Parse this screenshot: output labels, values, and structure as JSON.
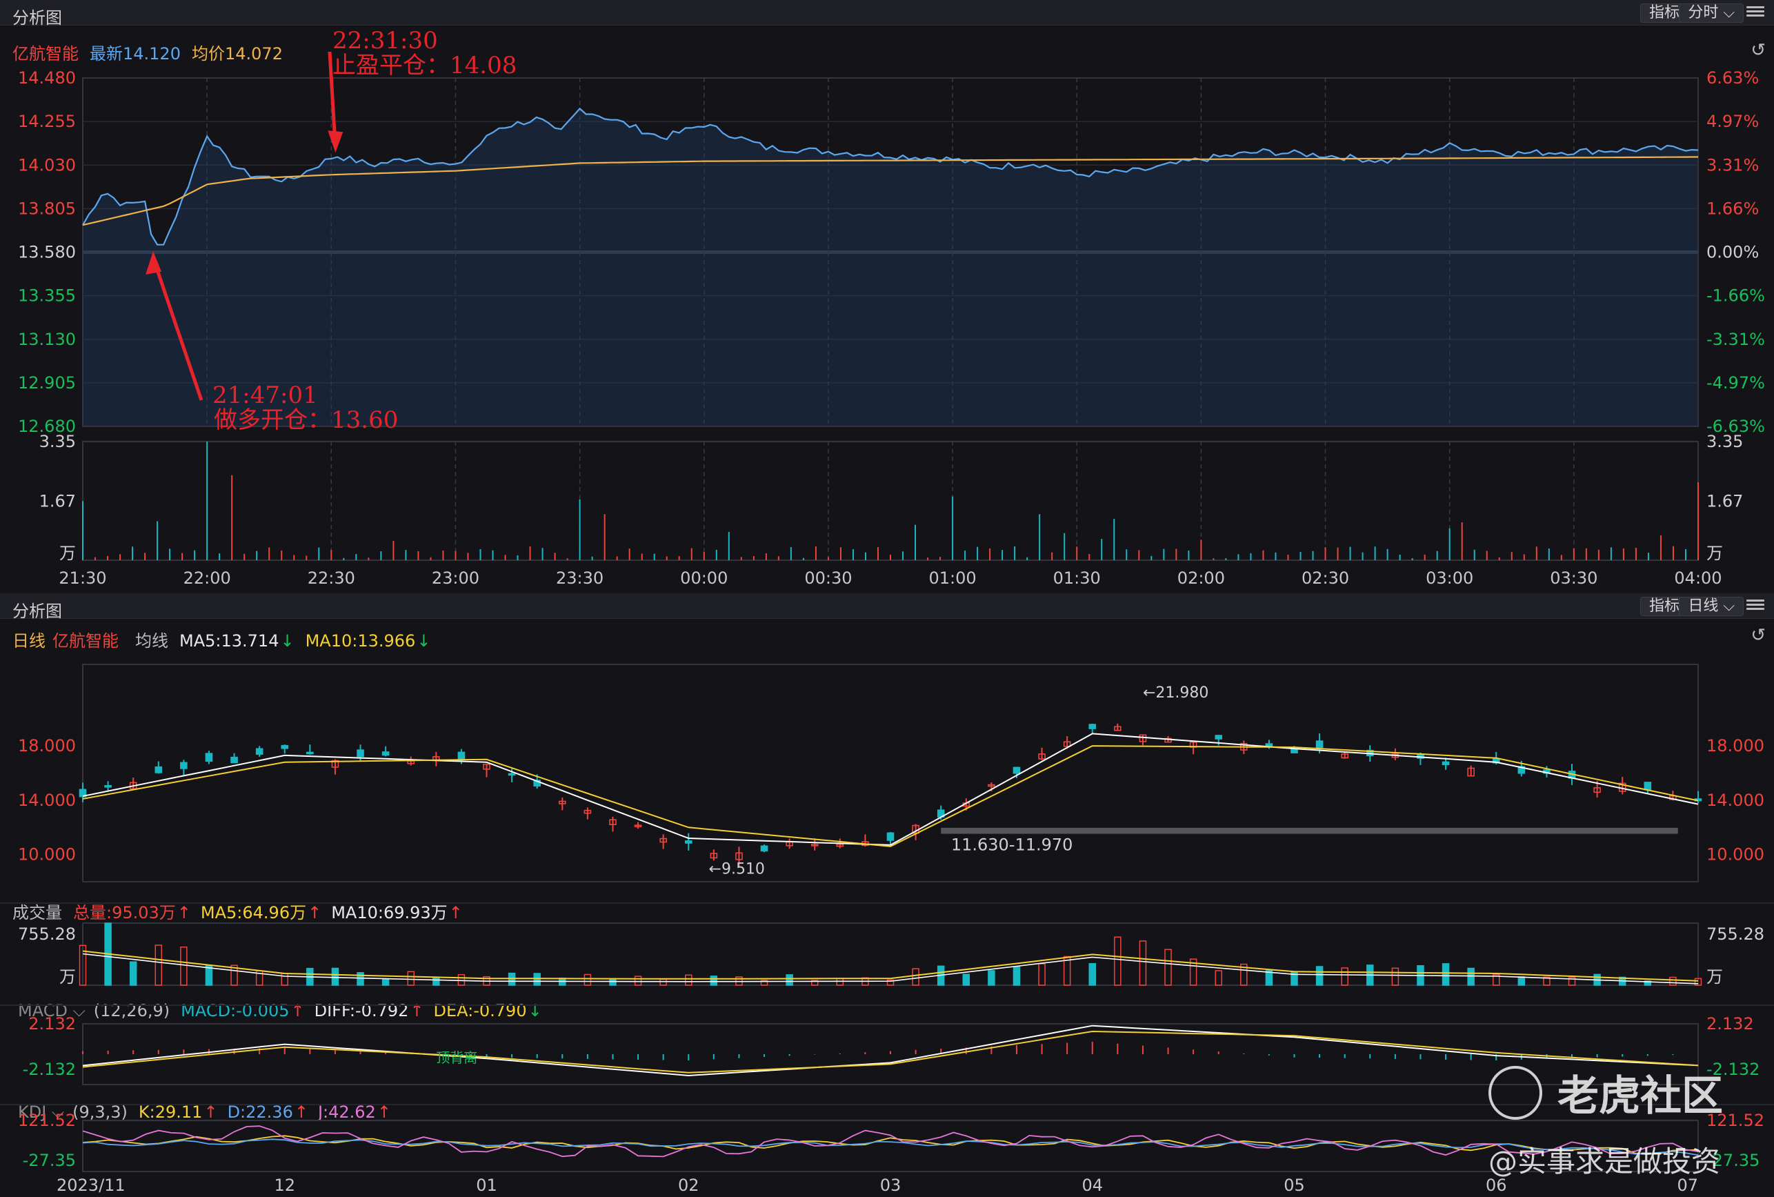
{
  "top": {
    "panel_title": "分析图",
    "indicator_btn": "指标",
    "period_btn": "分时 ⌵",
    "stock": "亿航智能",
    "latest_label": "最新14.120",
    "avg_label": "均价14.072",
    "price_ticks": [
      "14.480",
      "14.255",
      "14.030",
      "13.805",
      "13.580",
      "13.355",
      "13.130",
      "12.905",
      "12.680"
    ],
    "pct_ticks": [
      "6.63%",
      "4.97%",
      "3.31%",
      "1.66%",
      "0.00%",
      "-1.66%",
      "-3.31%",
      "-4.97%",
      "-6.63%"
    ],
    "vol_ticks": [
      "3.35",
      "1.67",
      "万"
    ],
    "time_ticks": [
      "21:30",
      "22:00",
      "22:30",
      "23:00",
      "23:30",
      "00:00",
      "00:30",
      "01:00",
      "01:30",
      "02:00",
      "02:30",
      "03:00",
      "03:30",
      "04:00"
    ],
    "ann_close_time": "22:31:30",
    "ann_close_text": "止盈平仓：14.08",
    "ann_open_time": "21:47:01",
    "ann_open_text": "做多开仓：13.60"
  },
  "bottom": {
    "panel_title": "分析图",
    "indicator_btn": "指标",
    "period_btn": "日线 ⌵",
    "kline_label": "日线",
    "stock": "亿航智能",
    "ma_label": "均线",
    "ma5": "MA5:13.714",
    "ma10": "MA10:13.966",
    "price_ticks": [
      "18.000",
      "14.000",
      "10.000"
    ],
    "high_label": "←21.980",
    "low_label": "←9.510",
    "range_label": "11.630-11.970",
    "vol_title": "成交量",
    "vol_total": "总量:95.03万",
    "vol_ma5": "MA5:64.96万",
    "vol_ma10": "MA10:69.93万",
    "vol_ticks": [
      "755.28",
      "万"
    ],
    "macd_name": "MACD ⌵",
    "macd_params": "(12,26,9)",
    "macd_val": "MACD:-0.005",
    "diff_val": "DIFF:-0.792",
    "dea_val": "DEA:-0.790",
    "macd_ticks": [
      "2.132",
      "-2.132"
    ],
    "macd_note": "顶背离",
    "kdj_name": "KDJ ⌵",
    "kdj_params": "(9,3,3)",
    "k_val": "K:29.11",
    "d_val": "D:22.36",
    "j_val": "J:42.62",
    "kdj_ticks": [
      "121.52",
      "-27.35"
    ],
    "date_ticks": [
      "2023/11",
      "12",
      "01",
      "02",
      "03",
      "04",
      "05",
      "06",
      "07"
    ]
  },
  "watermark": {
    "brand": "老虎社区",
    "author": "@实事求是做投资"
  },
  "colors": {
    "up": "#f0433c",
    "down": "#17b8c4",
    "price": "#5ba7f0",
    "avg": "#f0b24a",
    "ma10": "#f5d030",
    "text_dim": "#bdbdbd"
  },
  "chart_data": [
    {
      "type": "line",
      "title": "分时",
      "x_range": [
        "21:30",
        "04:00"
      ],
      "ylim": [
        12.68,
        14.48
      ],
      "series": [
        {
          "name": "最新",
          "x": [
            "21:30",
            "21:35",
            "21:40",
            "21:45",
            "21:47",
            "21:50",
            "21:55",
            "22:00",
            "22:05",
            "22:10",
            "22:20",
            "22:31",
            "22:40",
            "22:50",
            "23:00",
            "23:10",
            "23:20",
            "23:25",
            "23:30",
            "23:40",
            "23:50",
            "00:00",
            "00:15",
            "00:30",
            "00:45",
            "01:00",
            "01:10",
            "01:20",
            "01:30",
            "01:45",
            "02:00",
            "02:15",
            "02:30",
            "02:45",
            "03:00",
            "03:15",
            "03:30",
            "03:45",
            "04:00"
          ],
          "values": [
            13.72,
            13.9,
            13.82,
            13.85,
            13.6,
            13.64,
            13.9,
            14.19,
            14.05,
            13.98,
            13.95,
            14.08,
            14.03,
            14.07,
            14.02,
            14.22,
            14.27,
            14.19,
            14.32,
            14.25,
            14.17,
            14.24,
            14.12,
            14.1,
            14.08,
            14.06,
            14.02,
            14.04,
            13.98,
            14.0,
            14.06,
            14.1,
            14.08,
            14.05,
            14.13,
            14.09,
            14.1,
            14.11,
            14.12
          ]
        },
        {
          "name": "均价",
          "x": [
            "21:30",
            "21:50",
            "22:00",
            "22:10",
            "22:30",
            "23:00",
            "23:30",
            "00:00",
            "01:00",
            "02:00",
            "03:00",
            "04:00"
          ],
          "values": [
            13.72,
            13.82,
            13.93,
            13.96,
            13.98,
            14.0,
            14.04,
            14.05,
            14.055,
            14.06,
            14.065,
            14.072
          ]
        }
      ]
    },
    {
      "type": "bar",
      "title": "分时成交量",
      "ylim": [
        0,
        3.35
      ],
      "x": [
        "21:30",
        "21:47",
        "22:00",
        "22:05",
        "23:30",
        "23:35",
        "00:05",
        "00:50",
        "01:00",
        "01:20",
        "01:35",
        "03:00",
        "03:50",
        "04:00"
      ],
      "values": [
        1.67,
        1.1,
        3.35,
        2.4,
        1.72,
        1.3,
        0.8,
        1.0,
        1.8,
        1.3,
        0.6,
        0.9,
        0.7,
        2.2
      ]
    },
    {
      "type": "line",
      "title": "日线",
      "x": [
        "2023/11",
        "12",
        "01",
        "02",
        "03",
        "04",
        "05",
        "06",
        "07"
      ],
      "ylim": [
        8,
        24
      ],
      "series": [
        {
          "name": "收盘",
          "values": [
            14.6,
            17.6,
            16.6,
            10.4,
            10.8,
            19.4,
            17.9,
            16.5,
            13.9
          ]
        },
        {
          "name": "MA5",
          "values": [
            14.3,
            17.3,
            16.8,
            11.2,
            10.7,
            18.9,
            17.8,
            16.8,
            13.71
          ]
        },
        {
          "name": "MA10",
          "values": [
            14.1,
            16.8,
            17.0,
            12.0,
            10.6,
            18.0,
            17.9,
            17.1,
            13.97
          ]
        }
      ]
    },
    {
      "type": "bar",
      "title": "成交量",
      "x": [
        "2023/11",
        "12",
        "01",
        "02",
        "03",
        "04",
        "05",
        "06",
        "07"
      ],
      "values": [
        755.28,
        260,
        150,
        140,
        150,
        680,
        300,
        260,
        95.03
      ],
      "ylim": [
        0,
        755.28
      ]
    },
    {
      "type": "line",
      "title": "MACD",
      "x": [
        "2023/11",
        "12",
        "01",
        "02",
        "03",
        "04",
        "05",
        "06",
        "07"
      ],
      "ylim": [
        -2.132,
        2.132
      ],
      "series": [
        {
          "name": "DIFF",
          "values": [
            -0.8,
            0.7,
            -0.3,
            -1.5,
            -0.6,
            2.0,
            1.2,
            -0.1,
            -0.792
          ]
        },
        {
          "name": "DEA",
          "values": [
            -0.9,
            0.5,
            -0.2,
            -1.3,
            -0.7,
            1.6,
            1.3,
            0.1,
            -0.79
          ]
        }
      ]
    },
    {
      "type": "line",
      "title": "KDJ",
      "x": [
        "2023/11",
        "12",
        "01",
        "02",
        "03",
        "04",
        "05",
        "06",
        "07"
      ],
      "ylim": [
        -27.35,
        121.52
      ],
      "series": [
        {
          "name": "K",
          "values": [
            55,
            70,
            50,
            48,
            60,
            55,
            52,
            45,
            29.11
          ]
        },
        {
          "name": "D",
          "values": [
            50,
            62,
            52,
            50,
            55,
            54,
            50,
            48,
            22.36
          ]
        },
        {
          "name": "J",
          "values": [
            70,
            85,
            40,
            30,
            75,
            60,
            58,
            35,
            42.62
          ]
        }
      ]
    }
  ]
}
